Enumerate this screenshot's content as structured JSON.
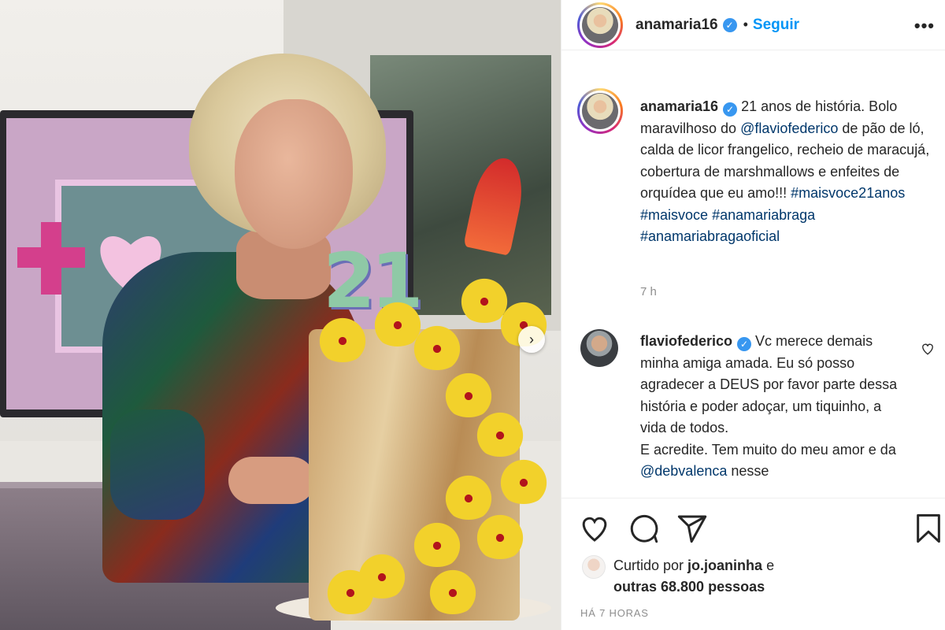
{
  "post": {
    "author": "anamaria16",
    "verified_mark": "✓",
    "separator": "•",
    "follow_label": "Seguir",
    "more_label": "•••",
    "image": {
      "overlay_number": "21",
      "carousel_next": "›"
    }
  },
  "caption": {
    "username": "anamaria16",
    "segments": {
      "s1": " 21 anos de história. Bolo maravilhoso do ",
      "mention1": "@flaviofederico",
      "s2": " de pão de ló, calda de licor frangelico, recheio de maracujá, cobertura de marshmallows e enfeites de orquídea que eu amo!!! ",
      "tag1": "#maisvoce21anos",
      "tag2": "#maisvoce",
      "tag3": "#anamariabraga",
      "tag4": "#anamariabragaoficial"
    },
    "time": "7 h"
  },
  "comment": {
    "username": "flaviofederico",
    "s1": " Vc merece demais minha amiga amada. ",
    "s2": "Eu só posso agradecer a DEUS por favor parte dessa história e poder adoçar, um tiquinho, a vida de todos.",
    "s3": "E acredite. Tem muito do meu amor e da ",
    "mention": "@debvalenca",
    "s4": " nesse"
  },
  "actions": {
    "icons": [
      "heart-icon",
      "comment-icon",
      "share-icon",
      "bookmark-icon"
    ],
    "liked_by_prefix": "Curtido por ",
    "liked_by_user": "jo.joaninha",
    "liked_by_and": " e",
    "liked_by_others": "outras 68.800 pessoas",
    "time_ago": "HÁ 7 HORAS"
  },
  "colors": {
    "link": "#00376b",
    "follow": "#0095f6",
    "verified": "#3897f0",
    "muted": "#8e8e8e"
  }
}
